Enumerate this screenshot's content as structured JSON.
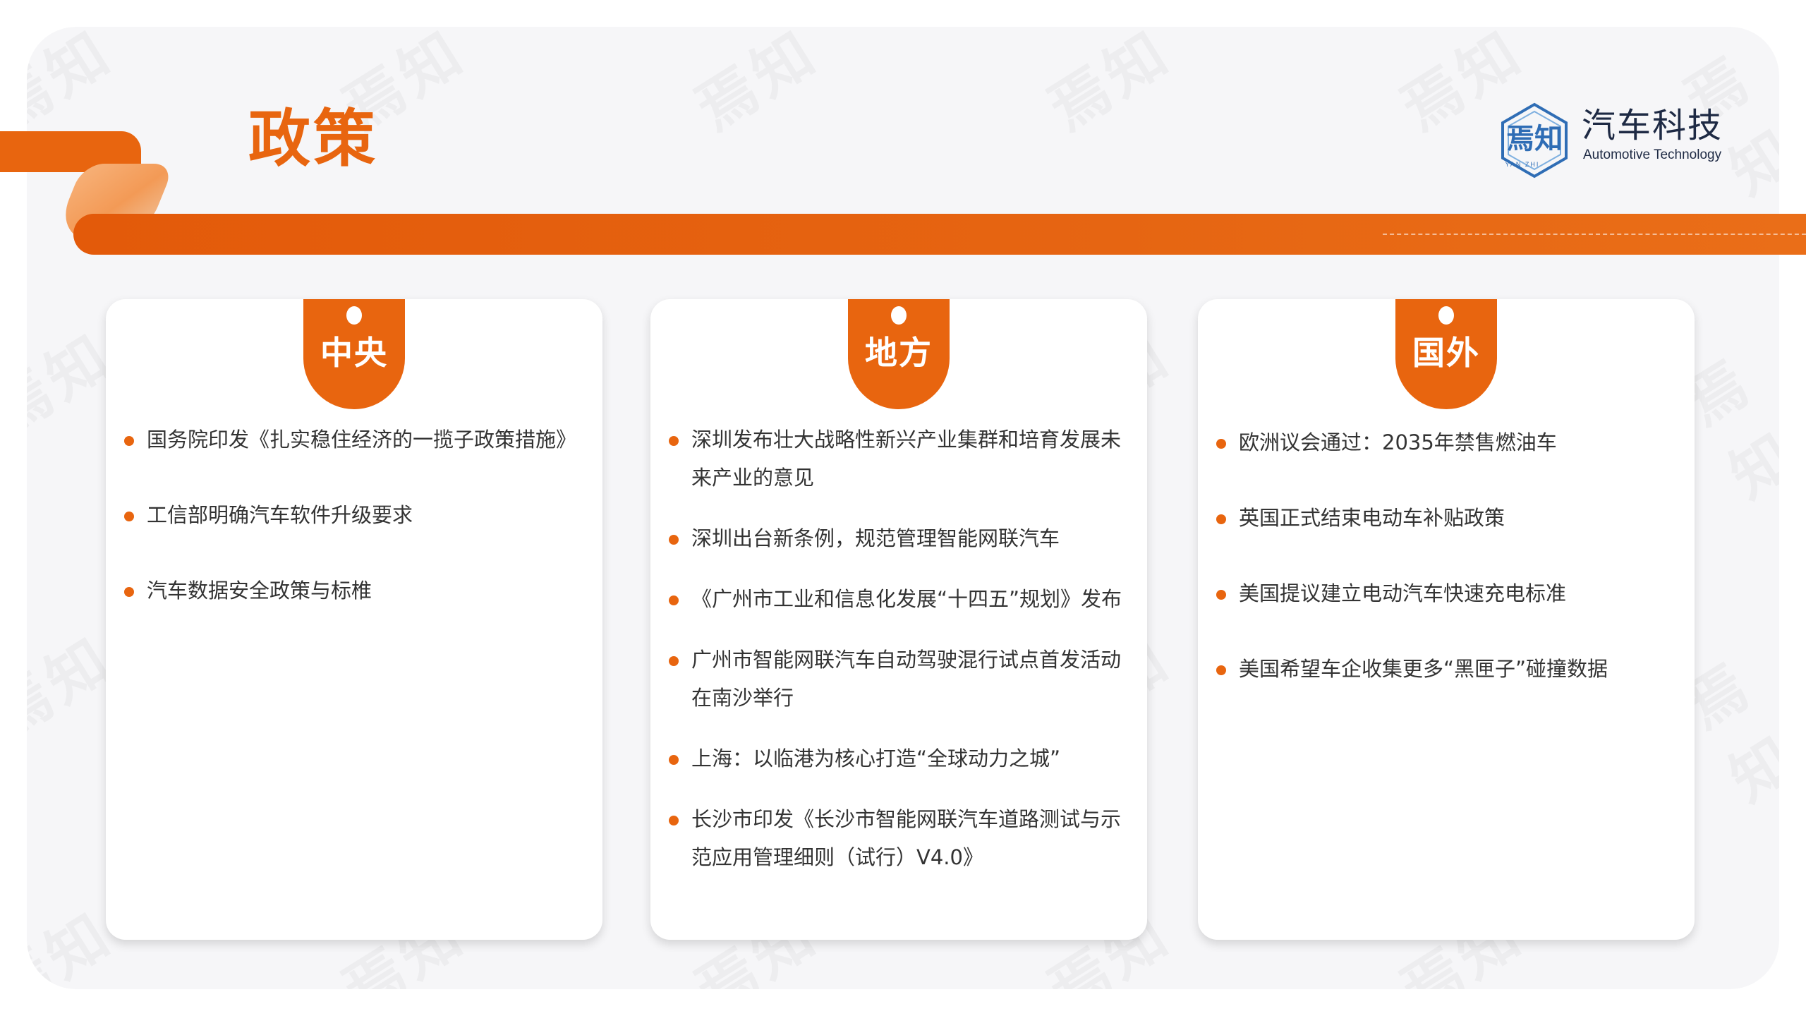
{
  "page": {
    "title": "政策",
    "accent_color": "#e8650f",
    "watermark_text": "焉知"
  },
  "logo": {
    "icon": "yanzhi-hexagon-logo-icon",
    "mark_text": "焉知",
    "mark_subtext": "YAN ZHI",
    "name_cn": "汽车科技",
    "name_en": "Automotive Technology"
  },
  "columns": [
    {
      "label": "中央",
      "items": [
        "国务院印发《扎实稳住经济的一揽子政策措施》",
        "工信部明确汽车软件升级要求",
        "汽车数据安全政策与标椎"
      ]
    },
    {
      "label": "地方",
      "items": [
        "深圳发布壮大战略性新兴产业集群和培育发展未来产业的意见",
        "深圳出台新条例，规范管理智能网联汽车",
        "《广州市工业和信息化发展“十四五”规划》发布",
        "广州市智能网联汽车自动驾驶混行试点首发活动在南沙举行",
        "上海：以临港为核心打造“全球动力之城”",
        "长沙市印发《长沙市智能网联汽车道路测试与示范应用管理细则（试行）V4.0》"
      ]
    },
    {
      "label": "国外",
      "items": [
        "欧洲议会通过：2035年禁售燃油车",
        "英国正式结束电动车补贴政策",
        "美国提议建立电动汽车快速充电标准",
        "美国希望车企收集更多“黑匣子”碰撞数据"
      ]
    }
  ]
}
